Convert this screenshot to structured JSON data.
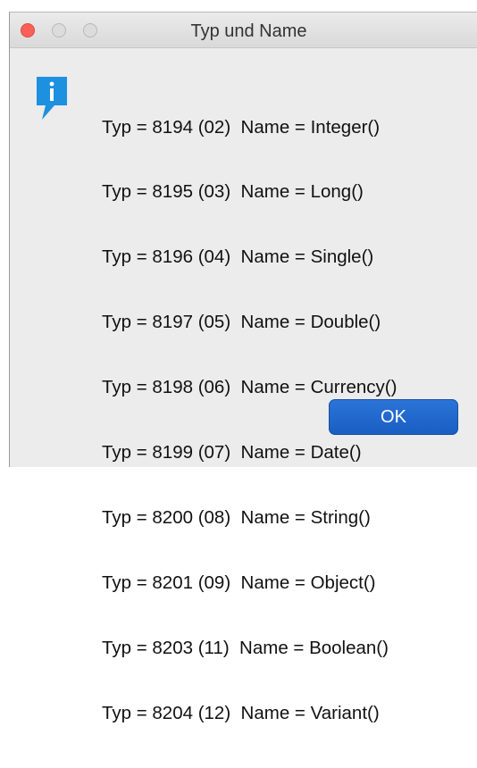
{
  "dialog": {
    "title": "Typ und Name",
    "icon": "info-icon",
    "icon_color": "#1e90e0",
    "lines": [
      "Typ = 8194 (02)  Name = Integer()",
      "Typ = 8195 (03)  Name = Long()",
      "Typ = 8196 (04)  Name = Single()",
      "Typ = 8197 (05)  Name = Double()",
      "Typ = 8198 (06)  Name = Currency()",
      "Typ = 8199 (07)  Name = Date()",
      "Typ = 8200 (08)  Name = String()",
      "Typ = 8201 (09)  Name = Object()",
      "Typ = 8203 (11)  Name = Boolean()",
      "Typ = 8204 (12)  Name = Variant()"
    ],
    "ok_label": "OK",
    "accent": "#1f66cc"
  }
}
